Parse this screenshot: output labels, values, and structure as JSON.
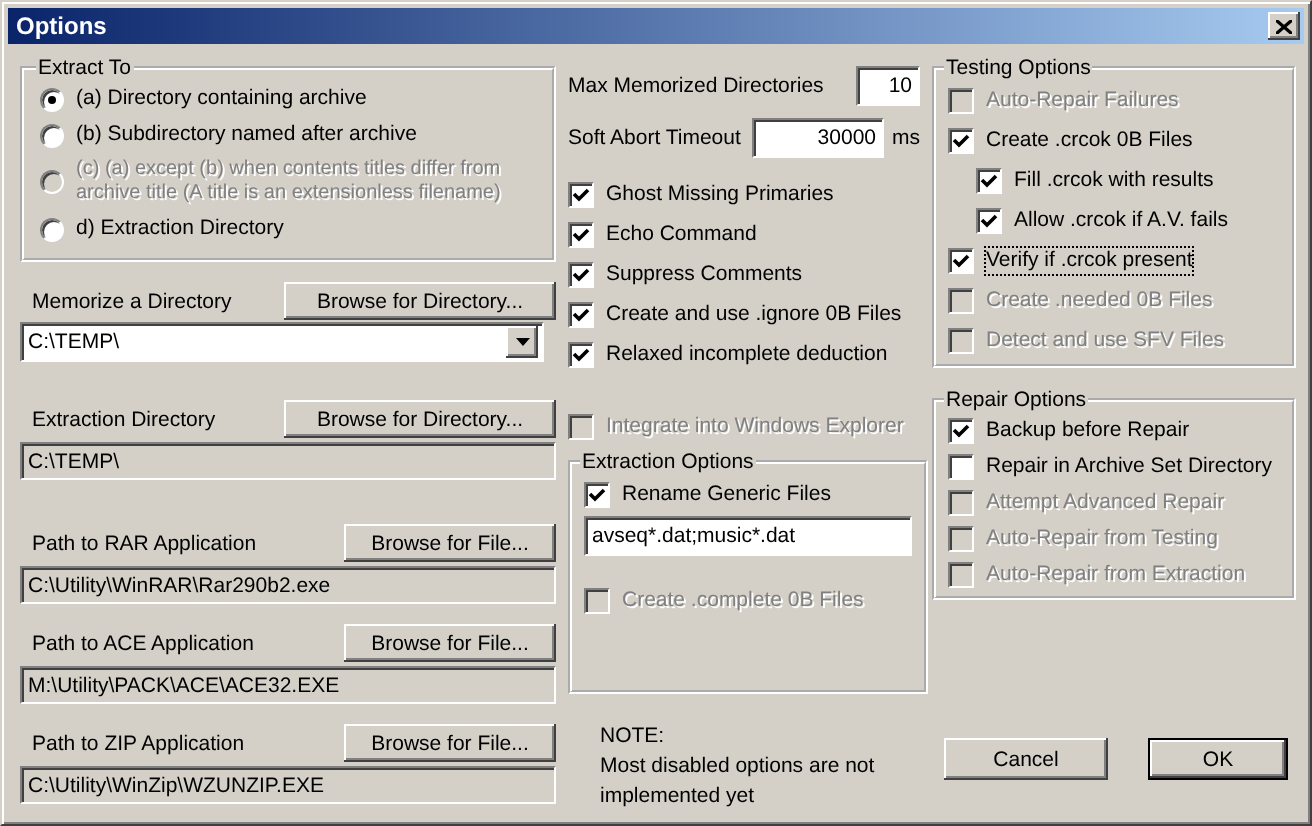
{
  "window": {
    "title": "Options"
  },
  "extract_to": {
    "title": "Extract To",
    "options": [
      {
        "label": "(a) Directory containing archive",
        "selected": true,
        "disabled": false
      },
      {
        "label": "(b) Subdirectory named after archive",
        "selected": false,
        "disabled": false
      },
      {
        "label": "(c) (a) except (b) when contents titles differ from archive title (A title is an extensionless filename)",
        "selected": false,
        "disabled": true
      },
      {
        "label": "d) Extraction Directory",
        "selected": false,
        "disabled": false
      }
    ]
  },
  "memorize": {
    "label": "Memorize a Directory",
    "button": "Browse for Directory...",
    "value": "C:\\TEMP\\"
  },
  "paths": [
    {
      "label": "Extraction Directory",
      "button": "Browse for Directory...",
      "value": "C:\\TEMP\\"
    },
    {
      "label": "Path to RAR Application",
      "button": "Browse for File...",
      "value": "C:\\Utility\\WinRAR\\Rar290b2.exe"
    },
    {
      "label": "Path to ACE Application",
      "button": "Browse for File...",
      "value": "M:\\Utility\\PACK\\ACE\\ACE32.EXE"
    },
    {
      "label": "Path to ZIP Application",
      "button": "Browse for File...",
      "value": "C:\\Utility\\WinZip\\WZUNZIP.EXE"
    }
  ],
  "max_memorized": {
    "label": "Max Memorized Directories",
    "value": "10"
  },
  "soft_abort": {
    "label": "Soft Abort Timeout",
    "value": "30000",
    "unit": "ms"
  },
  "general": [
    {
      "label": "Ghost Missing Primaries",
      "checked": true,
      "disabled": false
    },
    {
      "label": "Echo Command",
      "checked": true,
      "disabled": false
    },
    {
      "label": "Suppress Comments",
      "checked": true,
      "disabled": false
    },
    {
      "label": "Create and use .ignore 0B Files",
      "checked": true,
      "disabled": false
    },
    {
      "label": "Relaxed incomplete deduction",
      "checked": true,
      "disabled": false
    }
  ],
  "integrate": {
    "label": "Integrate into Windows Explorer",
    "checked": false,
    "disabled": true
  },
  "extraction_options": {
    "title": "Extraction Options",
    "rename": {
      "label": "Rename Generic Files",
      "checked": true,
      "disabled": false
    },
    "pattern": "avseq*.dat;music*.dat",
    "create_complete": {
      "label": "Create .complete 0B Files",
      "checked": false,
      "disabled": true
    }
  },
  "note": {
    "heading": "NOTE:",
    "text": "Most disabled options are not implemented yet"
  },
  "testing_options": {
    "title": "Testing Options",
    "items": [
      {
        "label": "Auto-Repair Failures",
        "checked": false,
        "disabled": true
      },
      {
        "label": "Create .crcok 0B Files",
        "checked": true,
        "disabled": false,
        "children": [
          {
            "label": "Fill .crcok with results",
            "checked": true,
            "disabled": false
          },
          {
            "label": "Allow .crcok if A.V. fails",
            "checked": true,
            "disabled": false
          }
        ]
      },
      {
        "label": "Verify if .crcok present",
        "checked": true,
        "disabled": false,
        "focused": true
      },
      {
        "label": "Create .needed 0B Files",
        "checked": false,
        "disabled": true
      },
      {
        "label": "Detect and use SFV Files",
        "checked": false,
        "disabled": true
      }
    ]
  },
  "repair_options": {
    "title": "Repair Options",
    "items": [
      {
        "label": "Backup before Repair",
        "checked": true,
        "disabled": false
      },
      {
        "label": "Repair in Archive Set Directory",
        "checked": false,
        "disabled": false
      },
      {
        "label": "Attempt Advanced Repair",
        "checked": false,
        "disabled": true
      },
      {
        "label": "Auto-Repair from Testing",
        "checked": false,
        "disabled": true
      },
      {
        "label": "Auto-Repair from Extraction",
        "checked": false,
        "disabled": true
      }
    ]
  },
  "buttons": [
    {
      "label": "Cancel",
      "kind": "normal"
    },
    {
      "label": "OK",
      "kind": "default"
    }
  ]
}
